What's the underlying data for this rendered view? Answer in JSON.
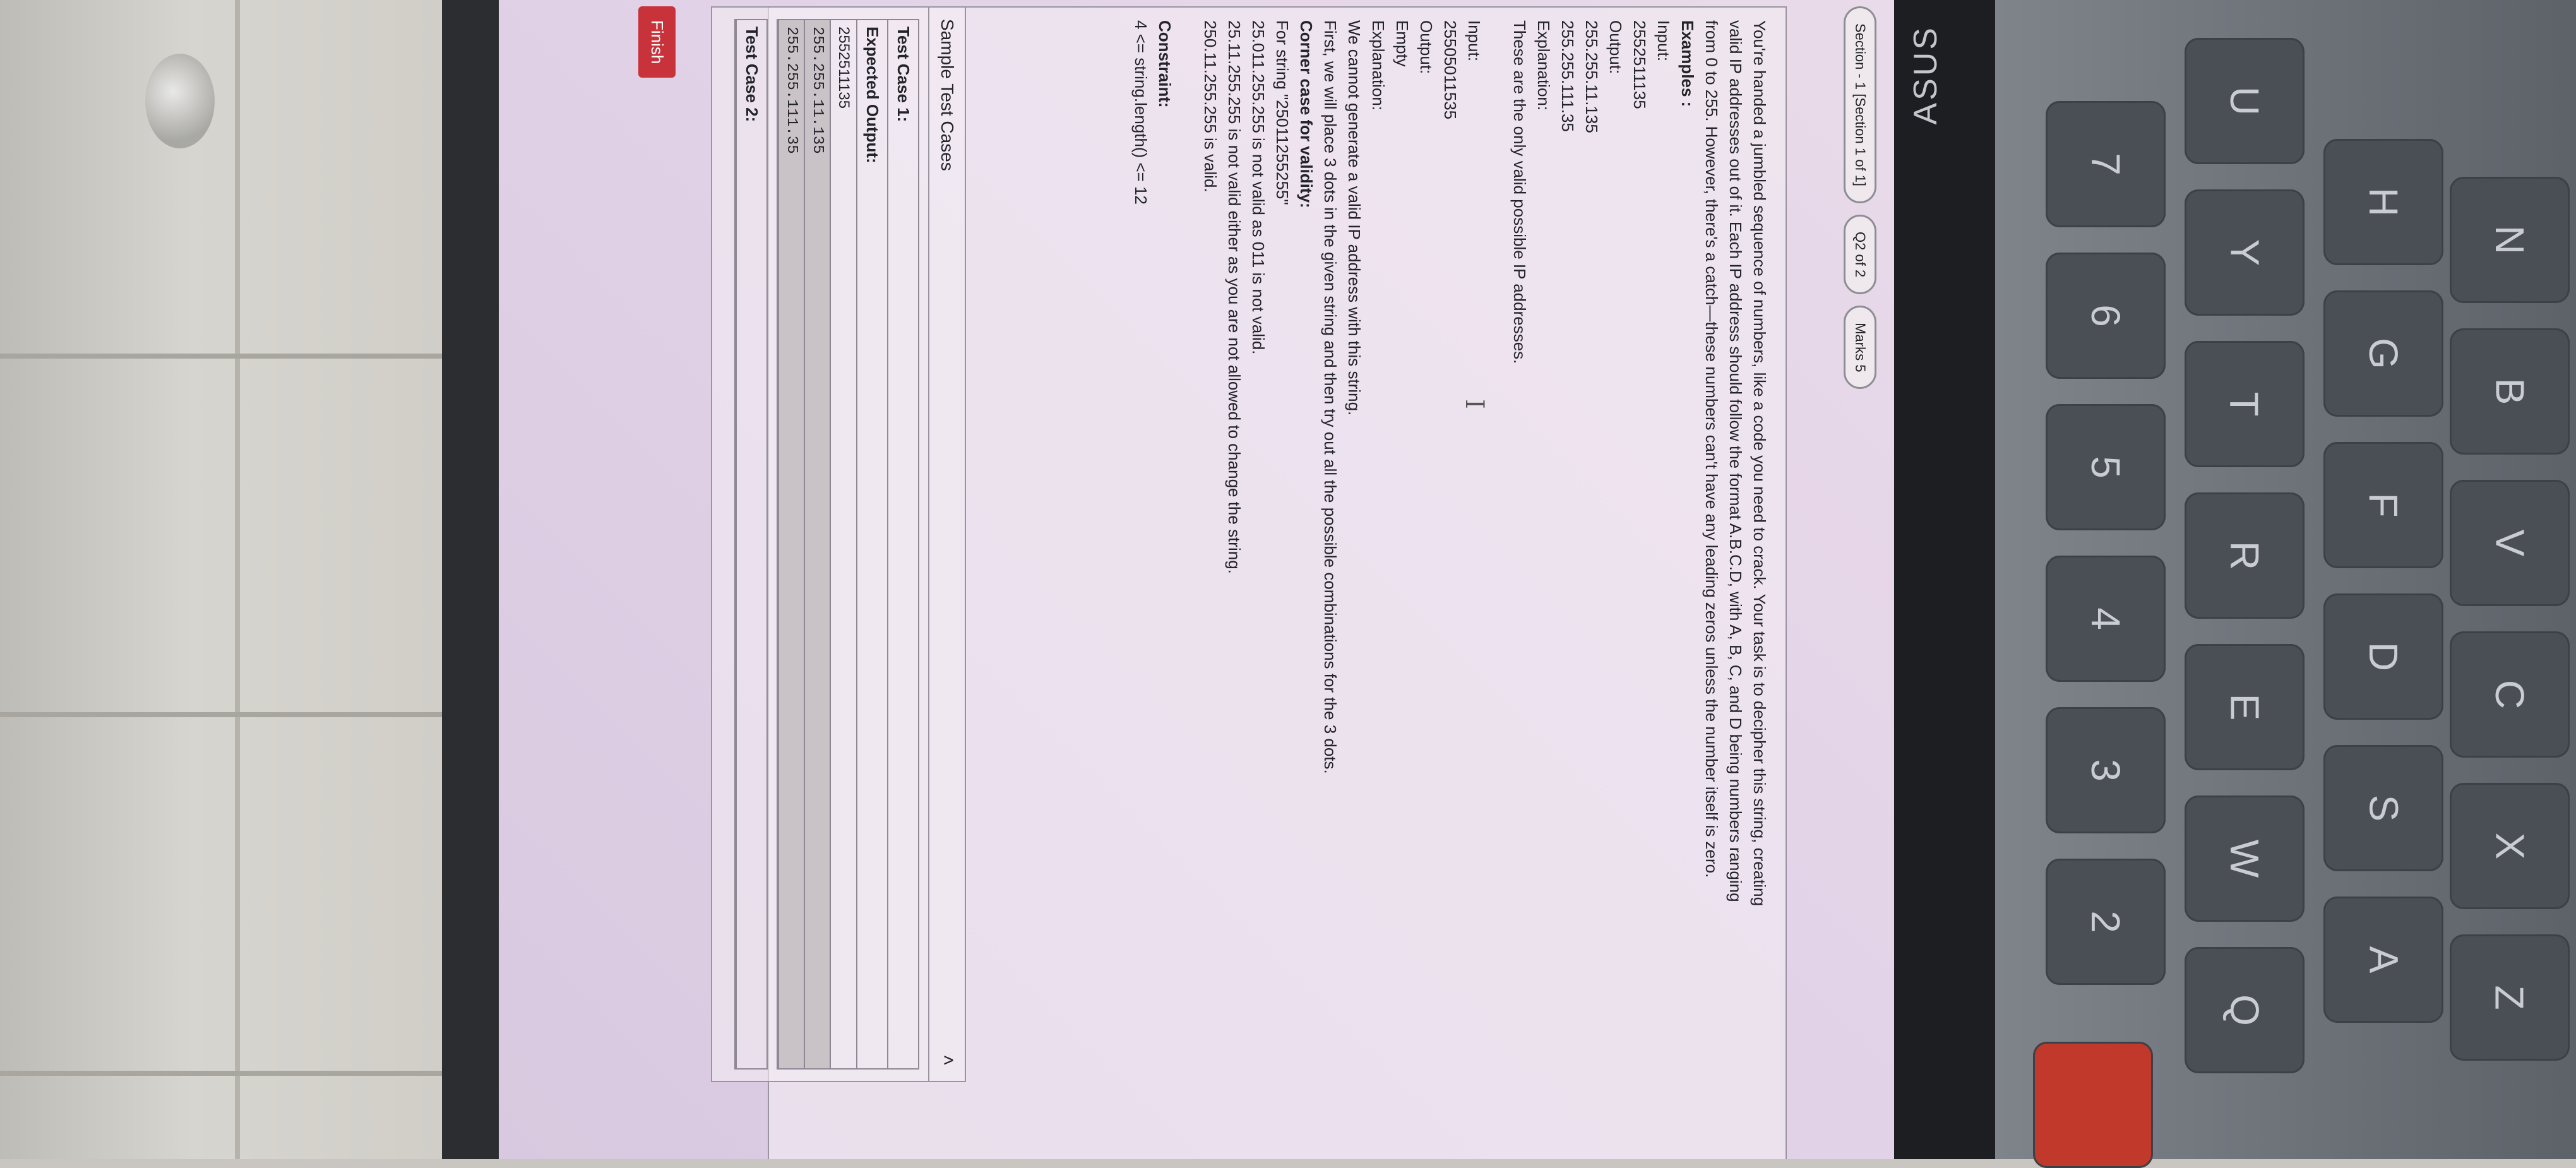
{
  "header": {
    "section_label": "Section - 1 [Section 1 of 1]",
    "question_label": "Q2 of 2",
    "marks_label": "Marks 5"
  },
  "problem": {
    "intro_lines": [
      "You're handed a jumbled sequence of numbers, like a code you need to crack. Your task is to decipher this string, creating",
      "valid IP addresses out of it. Each IP address should follow the format A.B.C.D, with A, B, C, and D being numbers ranging",
      "from 0 to 255. However, there's a catch—these numbers can't have any leading zeros unless the number itself is zero."
    ],
    "examples_heading": "Examples :",
    "example1": {
      "input_label": "Input:",
      "input_value": "2552511135",
      "output_label": "Output:",
      "output_lines": [
        "255.255.11.135",
        "255.255.111.35"
      ],
      "explanation_label": "Explanation:",
      "explanation": "These are the only valid possible IP addresses."
    },
    "example2": {
      "input_label": "Input:",
      "input_value": "25505011535",
      "output_label": "Output:",
      "output_value": "Empty",
      "explanation_label": "Explanation:",
      "explanation_lines": [
        "We cannot generate a valid IP address with this string.",
        "First, we will place 3 dots in the given string and then try out all the possible combinations for the 3 dots."
      ]
    },
    "corner_case": {
      "heading": "Corner case for validity:",
      "lines": [
        "For string \"25011255255\"",
        "25.011.255.255 is not valid as 011 is not valid.",
        "25.11.255.255 is not valid either as you are not allowed to change the string.",
        "250.11.255.255 is valid."
      ]
    },
    "constraint_heading": "Constraint:",
    "constraint_text": "4 <= string.length() <= 12"
  },
  "sample_tests": {
    "heading": "Sample Test Cases",
    "case1": {
      "title": "Test Case 1:",
      "expected_label": "Expected Output:",
      "input_value": "2552511135",
      "output_lines": [
        "255.255.11.135",
        "255.255.111.35"
      ]
    },
    "case2": {
      "title": "Test Case 2:"
    }
  },
  "finish_label": "Finish",
  "device": {
    "brand": "ASUS",
    "keys": [
      "2",
      "3",
      "4",
      "5",
      "6",
      "7",
      "Q",
      "W",
      "E",
      "R",
      "T",
      "Y",
      "U",
      "A",
      "S",
      "D",
      "F",
      "G",
      "H",
      "Z",
      "X",
      "C",
      "V",
      "B",
      "N"
    ]
  },
  "colors": {
    "finish_button": "#c8323a",
    "screen_bg": "#e6d6e8"
  }
}
